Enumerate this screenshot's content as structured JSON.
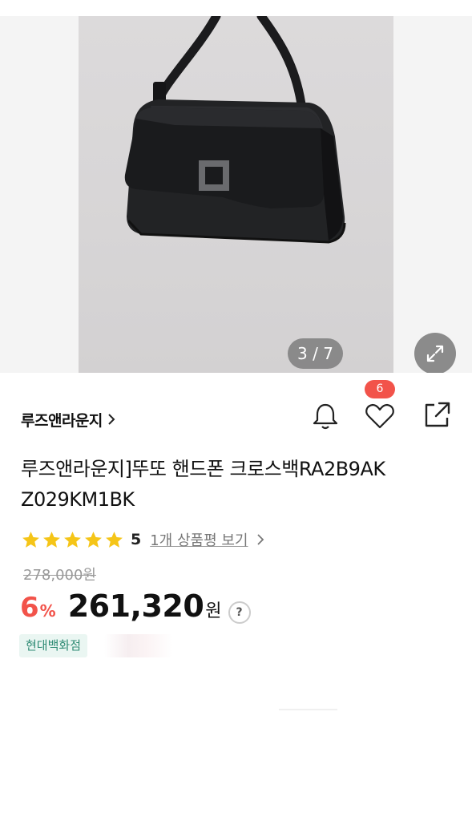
{
  "gallery": {
    "counter": "3 / 7",
    "expand_icon": "expand-arrows-icon"
  },
  "product": {
    "brand": "루즈앤라운지",
    "title_line1": "루즈앤라운지]뚜또 핸드폰 크로스백RA2B9AK",
    "title_line2": "Z029KM1BK",
    "rating": "5",
    "rating_stars": 5,
    "review_link": "1개 상품평 보기",
    "original_price": "278,000원",
    "discount": "6",
    "discount_unit": "%",
    "sale_price": "261,320",
    "currency": "원",
    "help": "?",
    "store_tag": "현대백화점"
  },
  "actions": {
    "wishlist_count": "6",
    "icons": [
      "bell-icon",
      "heart-icon",
      "share-icon"
    ]
  },
  "colors": {
    "accent_red": "#f2534a",
    "star_yellow": "#f5c518",
    "tag_green": "#2e8b74",
    "tag_bg": "#eaf6f2"
  }
}
